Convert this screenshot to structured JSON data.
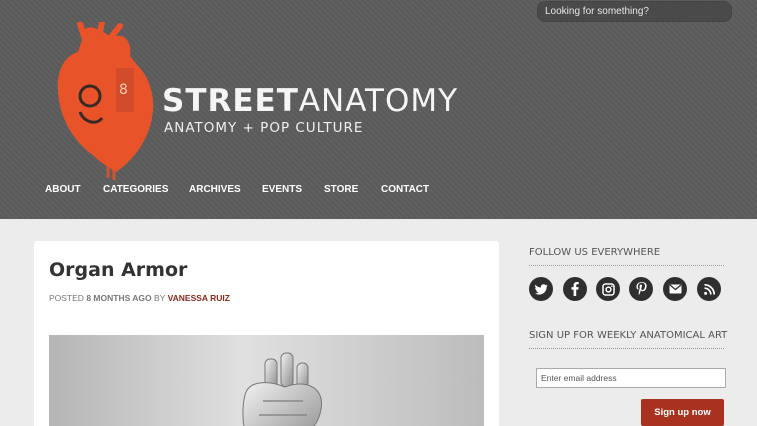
{
  "search": {
    "placeholder": "Looking for something?"
  },
  "logo": {
    "title_bold": "STREET",
    "title_light": "ANATOMY",
    "subtitle": "ANATOMY + POP CULTURE",
    "heart_color": "#e8532a"
  },
  "nav": [
    {
      "label": "ABOUT"
    },
    {
      "label": "CATEGORIES"
    },
    {
      "label": "ARCHIVES"
    },
    {
      "label": "EVENTS"
    },
    {
      "label": "STORE"
    },
    {
      "label": "CONTACT"
    }
  ],
  "post": {
    "title": "Organ Armor",
    "posted_prefix": "POSTED",
    "age": "8 MONTHS AGO",
    "by": "BY",
    "author": "VANESSA RUIZ"
  },
  "sidebar": {
    "follow_heading": "FOLLOW US EVERYWHERE",
    "social_icons": [
      "twitter-icon",
      "facebook-icon",
      "instagram-icon",
      "pinterest-icon",
      "email-icon",
      "rss-icon"
    ],
    "signup_heading": "SIGN UP FOR WEEKLY ANATOMICAL ART",
    "email_placeholder": "Enter email address",
    "signup_label": "Sign up now"
  },
  "colors": {
    "header_bg": "#5c5c5c",
    "accent": "#a8321f",
    "author_link": "#8a2a1d"
  }
}
